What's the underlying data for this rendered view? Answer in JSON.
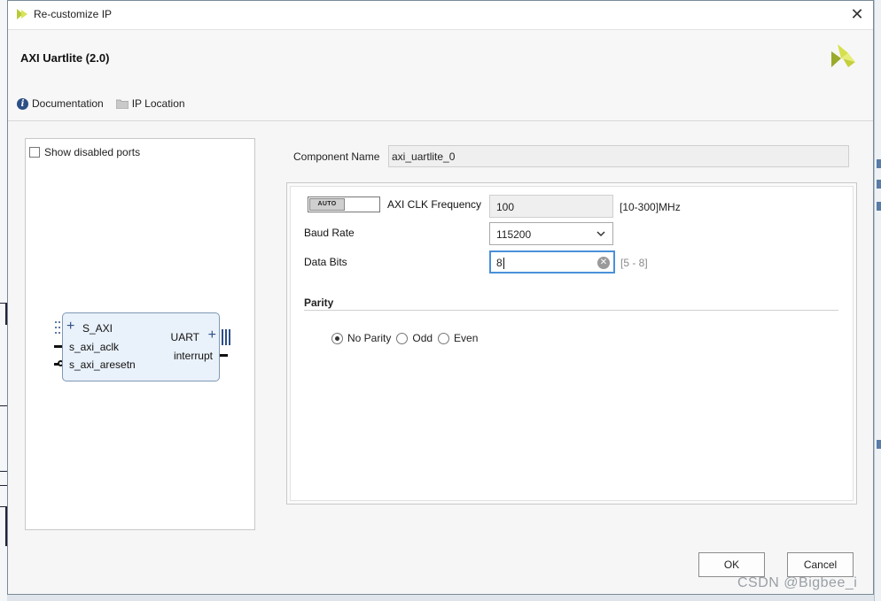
{
  "window": {
    "title": "Re-customize IP",
    "close_symbol": "✕"
  },
  "header": {
    "ip_name": "AXI Uartlite (2.0)",
    "documentation_label": "Documentation",
    "ip_location_label": "IP Location"
  },
  "left_panel": {
    "show_disabled_label": "Show disabled ports",
    "block": {
      "s_axi": "S_AXI",
      "aclk": "s_axi_aclk",
      "aresetn": "s_axi_aresetn",
      "uart": "UART",
      "interrupt": "interrupt"
    }
  },
  "component": {
    "label": "Component Name",
    "value": "axi_uartlite_0"
  },
  "config": {
    "auto_label": "AUTO",
    "clk_label": "AXI CLK Frequency",
    "clk_value": "100",
    "clk_range": "[10-300]MHz",
    "baud_label": "Baud Rate",
    "baud_value": "115200",
    "data_bits_label": "Data Bits",
    "data_bits_value": "8",
    "data_bits_range": "[5 - 8]",
    "parity_section": "Parity",
    "parity_options": [
      "No Parity",
      "Odd",
      "Even"
    ],
    "parity_selected": "No Parity"
  },
  "footer": {
    "ok_label": "OK",
    "cancel_label": "Cancel"
  },
  "watermark": "CSDN @Bigbee_i",
  "colors": {
    "accent": "#4a90d9",
    "block_fill": "#e9f1fa",
    "xilinx_green": "#c8d84a"
  }
}
